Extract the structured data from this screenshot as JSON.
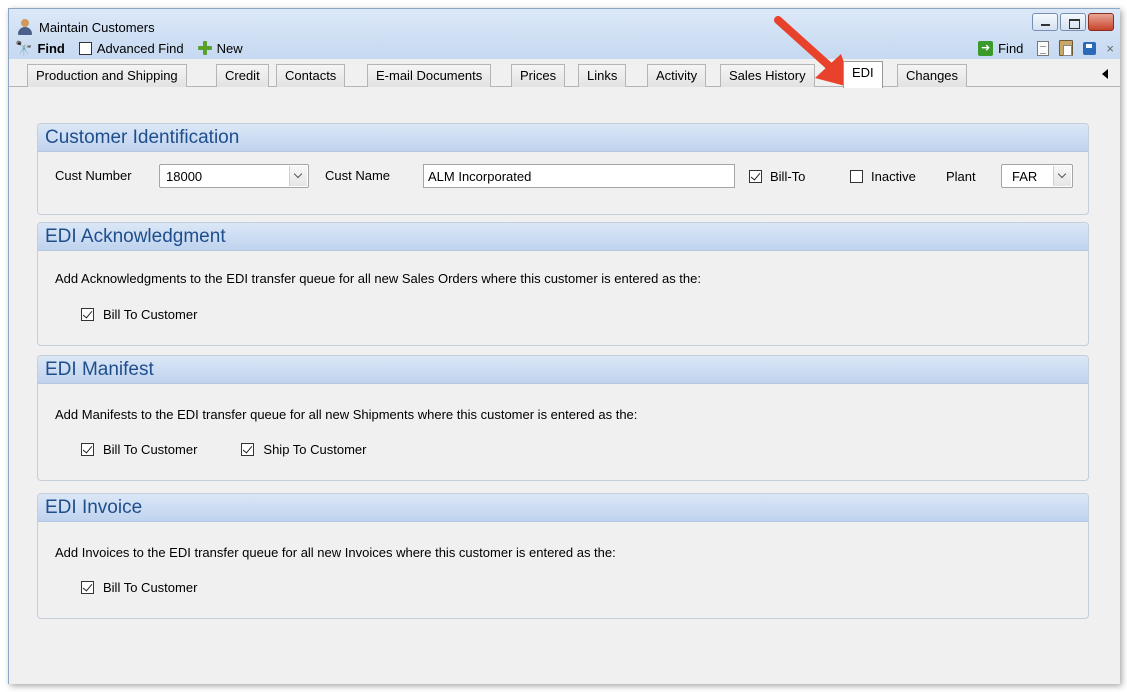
{
  "window": {
    "title": "Maintain Customers"
  },
  "toolbar": {
    "find_label": "Find",
    "advanced_find_label": "Advanced Find",
    "new_label": "New",
    "right_find_label": "Find",
    "close_glyph": "×"
  },
  "tabs": [
    {
      "label": "Production and Shipping",
      "active": false
    },
    {
      "label": "Credit",
      "active": false
    },
    {
      "label": "Contacts",
      "active": false
    },
    {
      "label": "E-mail Documents",
      "active": false
    },
    {
      "label": "Prices",
      "active": false
    },
    {
      "label": "Links",
      "active": false
    },
    {
      "label": "Activity",
      "active": false
    },
    {
      "label": "Sales History",
      "active": false
    },
    {
      "label": "EDI",
      "active": true
    },
    {
      "label": "Changes",
      "active": false
    }
  ],
  "customer_identification": {
    "header": "Customer Identification",
    "cust_number_label": "Cust Number",
    "cust_number_value": "18000",
    "cust_name_label": "Cust Name",
    "cust_name_value": "ALM Incorporated",
    "bill_to_label": "Bill-To",
    "bill_to_checked": true,
    "inactive_label": "Inactive",
    "inactive_checked": false,
    "plant_label": "Plant",
    "plant_value": "FAR"
  },
  "edi_acknowledgment": {
    "header": "EDI Acknowledgment",
    "description": "Add Acknowledgments to the EDI transfer queue for all new Sales Orders where this customer is entered as the:",
    "bill_to_customer_label": "Bill To Customer",
    "bill_to_customer_checked": true
  },
  "edi_manifest": {
    "header": "EDI Manifest",
    "description": "Add Manifests to the EDI transfer queue for all new Shipments where this customer is entered as the:",
    "bill_to_customer_label": "Bill To Customer",
    "bill_to_customer_checked": true,
    "ship_to_customer_label": "Ship To Customer",
    "ship_to_customer_checked": true
  },
  "edi_invoice": {
    "header": "EDI Invoice",
    "description": "Add Invoices to the EDI transfer queue for all new Invoices where this customer is entered as the:",
    "bill_to_customer_label": "Bill To Customer",
    "bill_to_customer_checked": true
  },
  "colors": {
    "group_header_text": "#1f4e8c",
    "annotation_arrow": "#e8412c"
  }
}
